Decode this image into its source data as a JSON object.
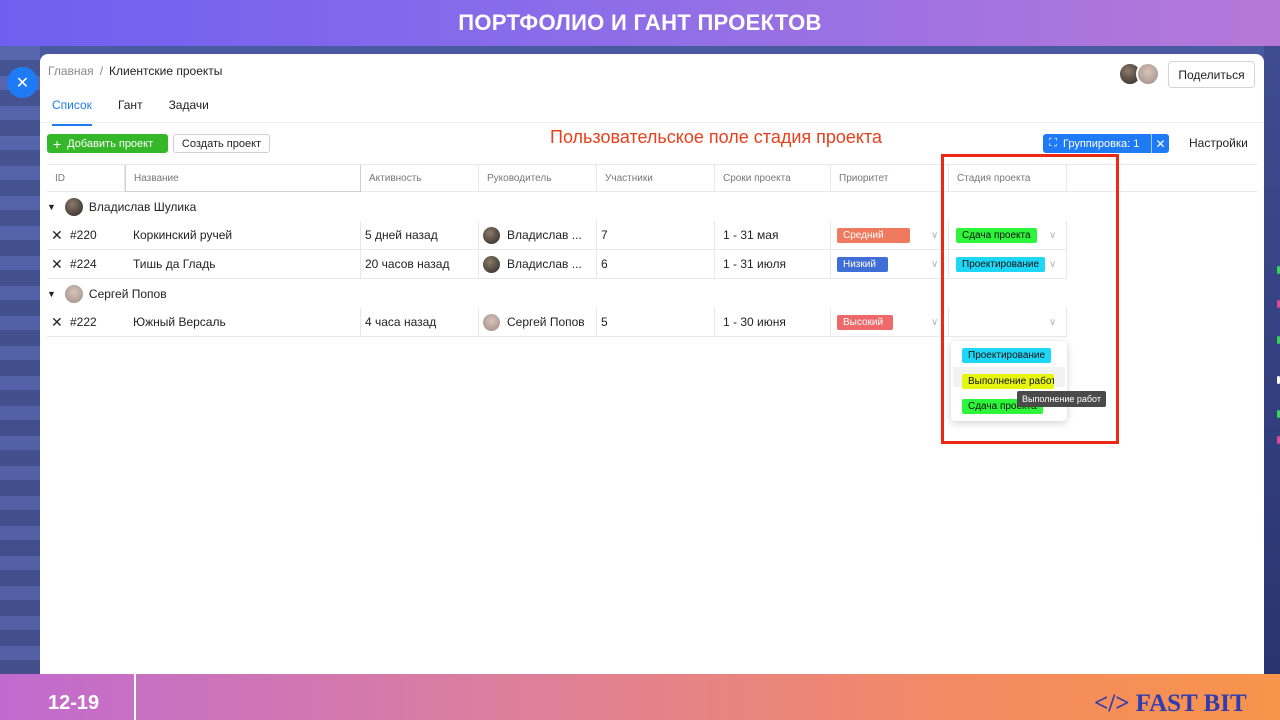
{
  "slide": {
    "title": "ПОРТФОЛИО И ГАНТ ПРОЕКТОВ",
    "page_number": "12-19",
    "brand": "</> FAST BIT"
  },
  "breadcrumb": {
    "home": "Главная",
    "separator": "/",
    "current": "Клиентские проекты"
  },
  "header": {
    "share_label": "Поделиться"
  },
  "tabs": [
    {
      "label": "Список",
      "active": true
    },
    {
      "label": "Гант",
      "active": false
    },
    {
      "label": "Задачи",
      "active": false
    }
  ],
  "toolbar": {
    "add_label": "Добавить проект",
    "create_label": "Создать проект",
    "grouping_label": "Группировка: 1",
    "settings_label": "Настройки"
  },
  "annotation": "Пользовательское поле стадия проекта",
  "table": {
    "columns": [
      "ID",
      "Название",
      "Активность",
      "Руководитель",
      "Участники",
      "Сроки проекта",
      "Приоритет",
      "Стадия проекта"
    ],
    "groups": [
      {
        "name": "Владислав Шулика",
        "rows": [
          {
            "id": "#220",
            "name": "Коркинский ручей",
            "activity": "5 дней назад",
            "manager": "Владислав ...",
            "members": "7",
            "dates": "1 - 31 мая",
            "priority": "Средний",
            "stage": "Сдача проекта"
          },
          {
            "id": "#224",
            "name": "Тишь да Гладь",
            "activity": "20 часов назад",
            "manager": "Владислав ...",
            "members": "6",
            "dates": "1 - 31 июля",
            "priority": "Низкий",
            "stage": "Проектирование"
          }
        ]
      },
      {
        "name": "Сергей Попов",
        "rows": [
          {
            "id": "#222",
            "name": "Южный Версаль",
            "activity": "4 часа назад",
            "manager": "Сергей Попов",
            "members": "5",
            "dates": "1 - 30 июня",
            "priority": "Высокий",
            "stage": ""
          }
        ]
      }
    ]
  },
  "dropdown": {
    "options": [
      "Проектирование",
      "Выполнение работ",
      "Сдача проекта"
    ],
    "tooltip": "Выполнение работ"
  },
  "colors": {
    "accent": "#1f7bf5",
    "add_button": "#35b72a",
    "priority_medium": "#f07a5f",
    "priority_low": "#3f6fd6",
    "priority_high": "#ee6a6a",
    "stage_design": "#1ed7f7",
    "stage_work": "#e6f50f",
    "stage_delivery": "#2df53a",
    "annotation": "#e8401c"
  }
}
